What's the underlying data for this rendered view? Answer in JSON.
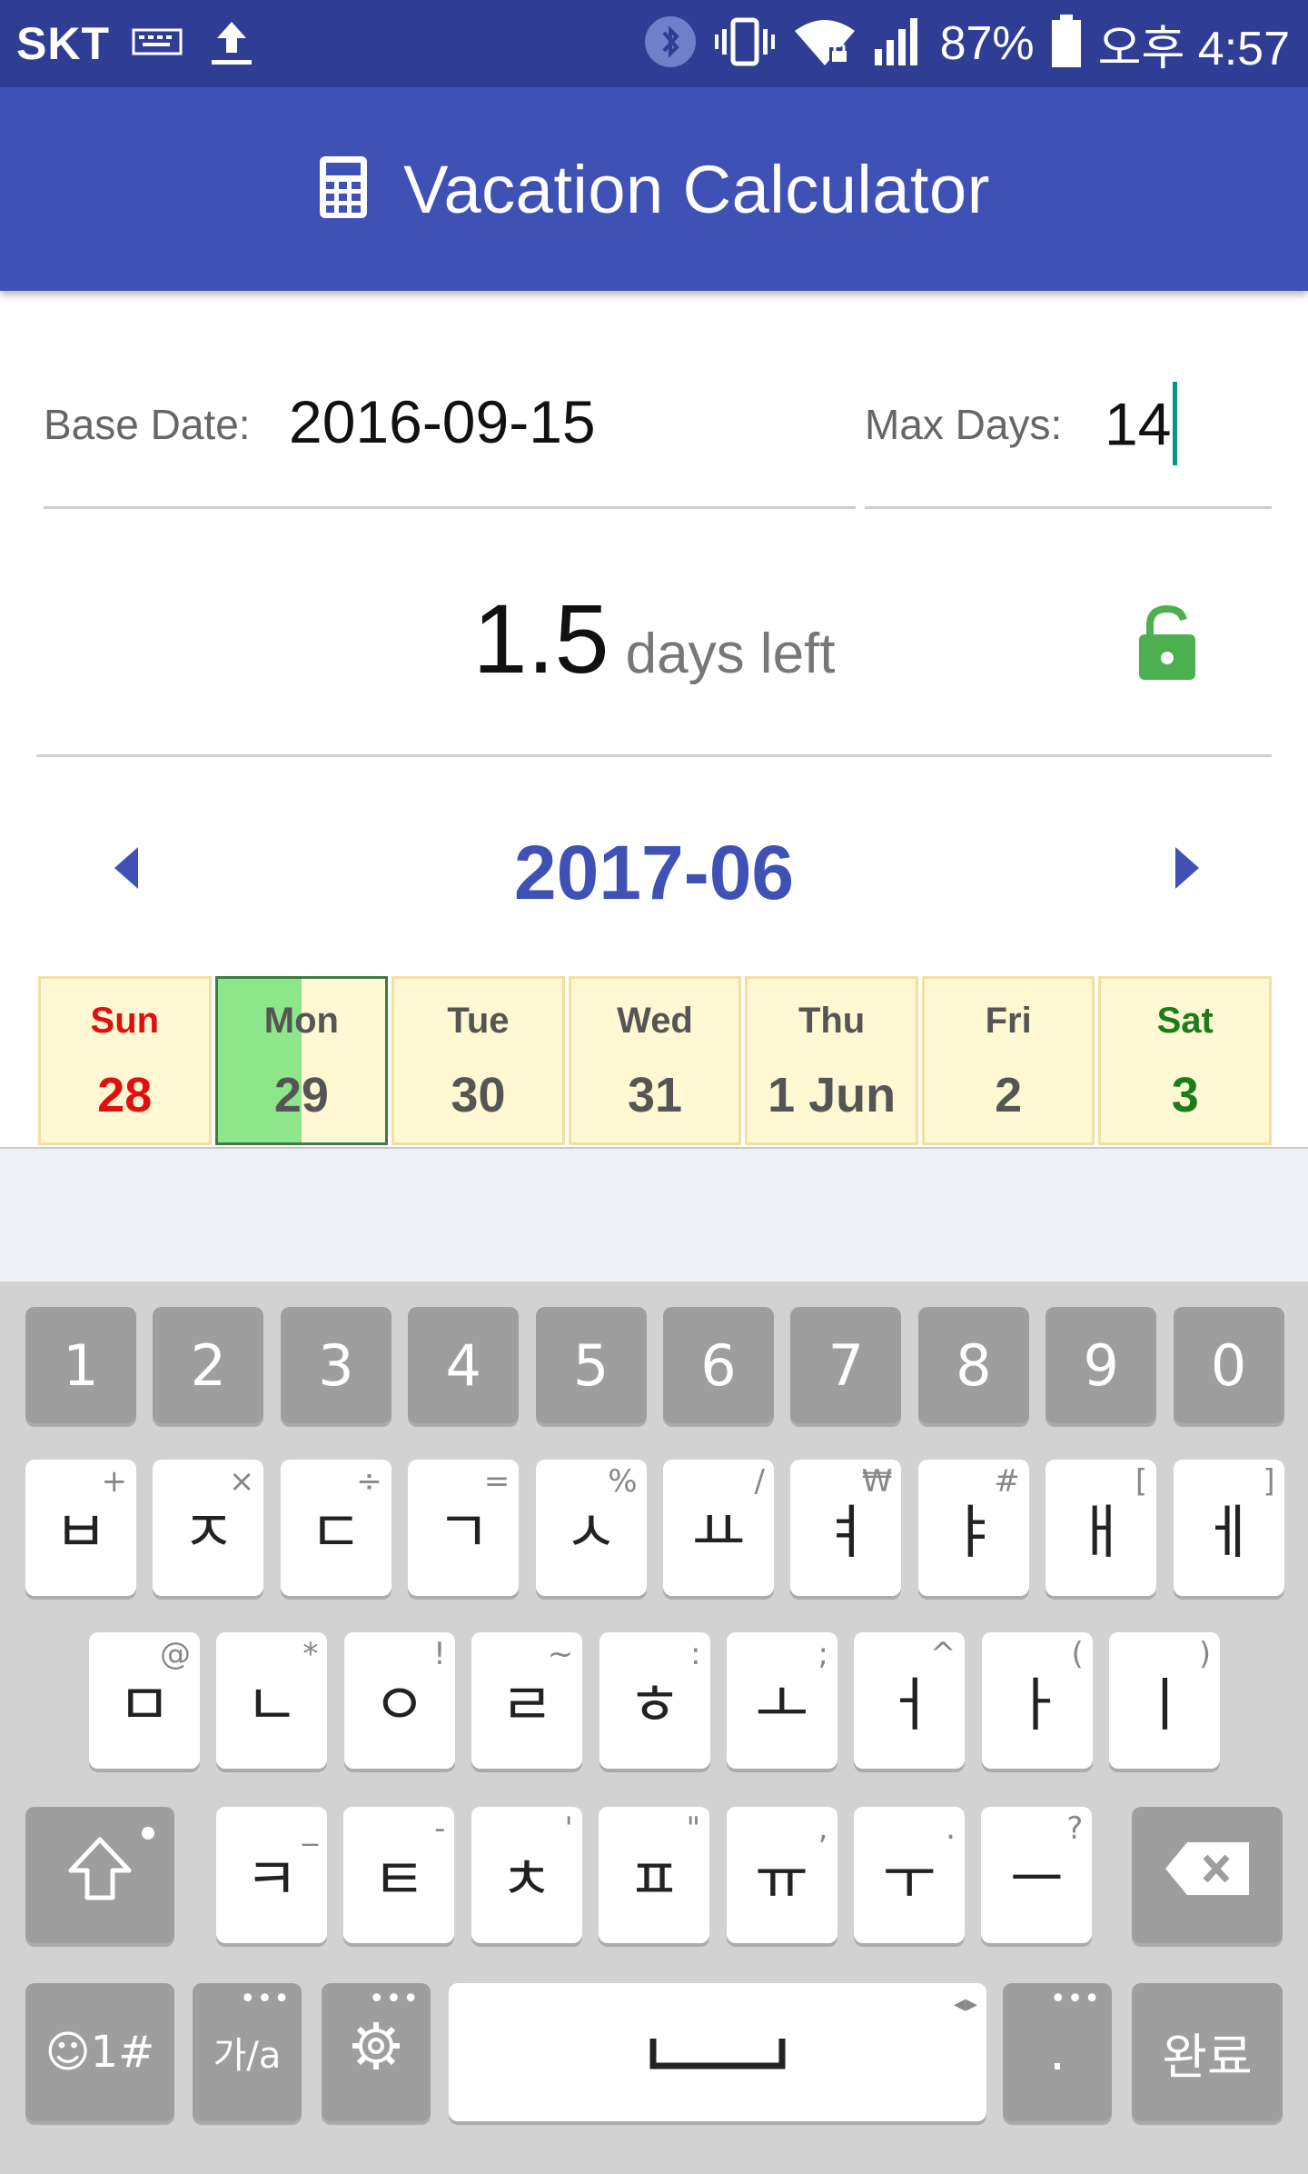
{
  "status_bar": {
    "carrier": "SKT",
    "battery_pct": "87%",
    "time": "오후 4:57",
    "icons": [
      "keyboard-icon",
      "upload-icon",
      "bluetooth-icon",
      "vibrate-icon",
      "wifi-lock-icon",
      "signal-icon",
      "battery-icon"
    ]
  },
  "app_bar": {
    "icon": "calculator-icon",
    "title": "Vacation Calculator",
    "color": "#3f51b5"
  },
  "form": {
    "base_date_label": "Base Date:",
    "base_date_value": "2016-09-15",
    "max_days_label": "Max Days:",
    "max_days_value": "14"
  },
  "summary": {
    "days_left": "1.5",
    "days_left_unit": "days left",
    "lock_icon": "unlocked-lock-icon",
    "lock_color": "#4caf50"
  },
  "calendar": {
    "month": "2017-06",
    "days": [
      {
        "name": "Sun",
        "num": "28",
        "kind": "sun"
      },
      {
        "name": "Mon",
        "num": "29",
        "kind": "weekday",
        "selected": true,
        "fill_fraction": 0.5
      },
      {
        "name": "Tue",
        "num": "30",
        "kind": "weekday"
      },
      {
        "name": "Wed",
        "num": "31",
        "kind": "weekday"
      },
      {
        "name": "Thu",
        "num": "1 Jun",
        "kind": "weekday"
      },
      {
        "name": "Fri",
        "num": "2",
        "kind": "weekday"
      },
      {
        "name": "Sat",
        "num": "3",
        "kind": "sat"
      }
    ]
  },
  "keyboard": {
    "number_row": [
      "1",
      "2",
      "3",
      "4",
      "5",
      "6",
      "7",
      "8",
      "9",
      "0"
    ],
    "row1": [
      {
        "key": "ㅂ",
        "sub": "+"
      },
      {
        "key": "ㅈ",
        "sub": "×"
      },
      {
        "key": "ㄷ",
        "sub": "÷"
      },
      {
        "key": "ㄱ",
        "sub": "="
      },
      {
        "key": "ㅅ",
        "sub": "%"
      },
      {
        "key": "ㅛ",
        "sub": "/"
      },
      {
        "key": "ㅕ",
        "sub": "₩"
      },
      {
        "key": "ㅑ",
        "sub": "#"
      },
      {
        "key": "ㅐ",
        "sub": "["
      },
      {
        "key": "ㅔ",
        "sub": "]"
      }
    ],
    "row2": [
      {
        "key": "ㅁ",
        "sub": "@"
      },
      {
        "key": "ㄴ",
        "sub": "*"
      },
      {
        "key": "ㅇ",
        "sub": "!"
      },
      {
        "key": "ㄹ",
        "sub": "~"
      },
      {
        "key": "ㅎ",
        "sub": ":"
      },
      {
        "key": "ㅗ",
        "sub": ";"
      },
      {
        "key": "ㅓ",
        "sub": "^"
      },
      {
        "key": "ㅏ",
        "sub": "("
      },
      {
        "key": "ㅣ",
        "sub": ")"
      }
    ],
    "row3": [
      {
        "key": "ㅋ",
        "sub": "_"
      },
      {
        "key": "ㅌ",
        "sub": "-"
      },
      {
        "key": "ㅊ",
        "sub": "'"
      },
      {
        "key": "ㅍ",
        "sub": "\""
      },
      {
        "key": "ㅠ",
        "sub": ","
      },
      {
        "key": "ㅜ",
        "sub": "."
      },
      {
        "key": "ㅡ",
        "sub": "?"
      }
    ],
    "emoji_label": "☺1#",
    "lang_label": "가/a",
    "period_label": ".",
    "done_label": "완료"
  }
}
